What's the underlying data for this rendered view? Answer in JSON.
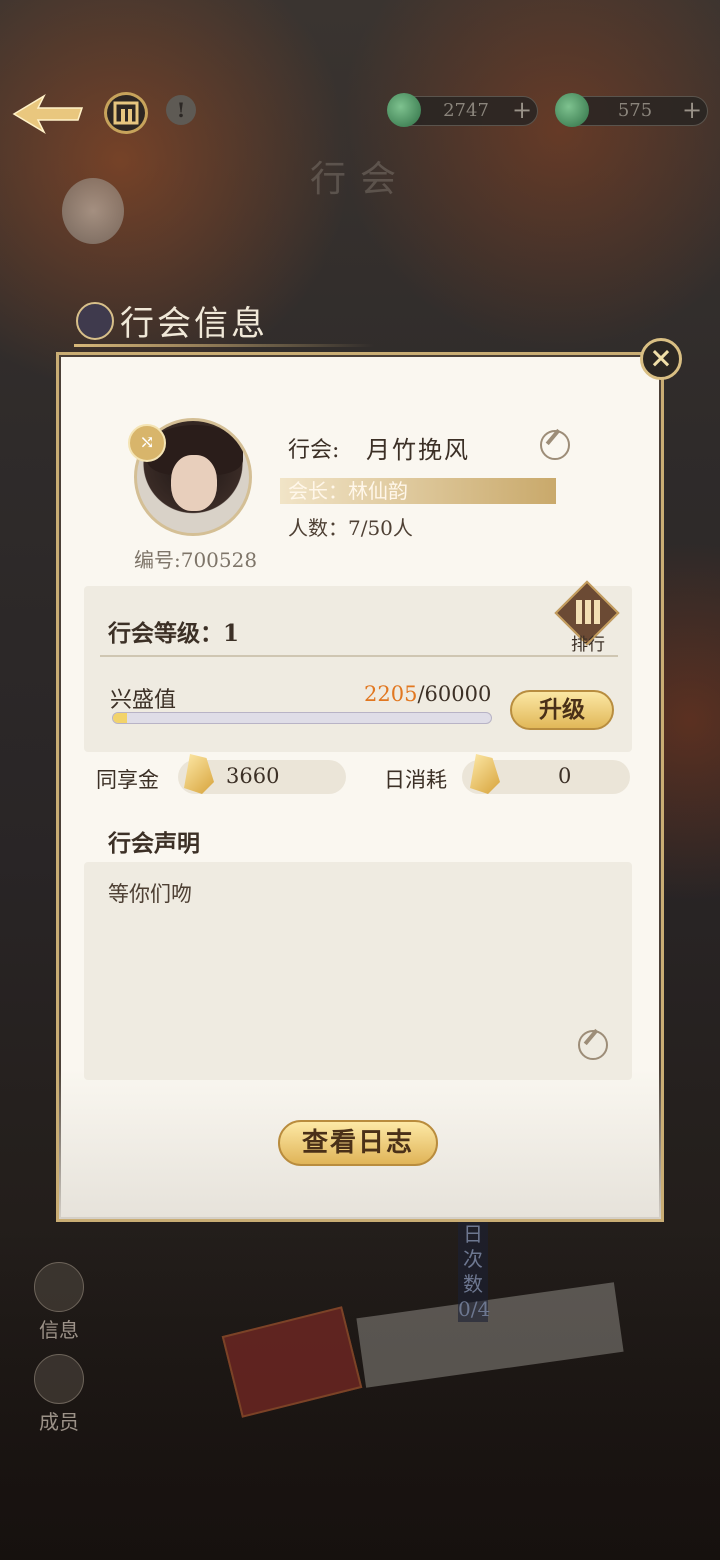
{
  "topbar": {
    "currency_jade": "2747",
    "currency_green": "575",
    "page_title": "行会"
  },
  "section": {
    "title": "行会信息"
  },
  "guild": {
    "name_label": "行会:",
    "name": "月竹挽风",
    "leader": "会长：林仙韵",
    "members": "人数：7/50人",
    "id": "编号:700528"
  },
  "level": {
    "label": "行会等级：1",
    "rank_label": "排行",
    "prosperity_label": "兴盛值",
    "prosperity_current": "2205",
    "prosperity_max": "/60000",
    "prosperity_fraction": 0.0368,
    "upgrade_label": "升级"
  },
  "funds": {
    "shared_label": "同享金",
    "shared_value": "3660",
    "daily_label": "日消耗",
    "daily_value": "0"
  },
  "statement": {
    "title": "行会声明",
    "text": "等你们吻"
  },
  "buttons": {
    "view_log": "查看日志"
  },
  "side_nav": {
    "info": "信息",
    "members": "成员"
  },
  "daily_count": "日次数0/4",
  "colors": {
    "accent_orange": "#e17720",
    "gold": "#e0b458",
    "panel_bg": "#faf7f0"
  },
  "icons": [
    "back-arrow-icon",
    "home-icon",
    "info-icon",
    "jade-coin-icon",
    "green-gem-icon",
    "plus-icon",
    "close-icon",
    "shuffle-icon",
    "edit-icon",
    "rank-icon",
    "gold-ingot-icon",
    "nav-info-icon",
    "nav-members-icon"
  ]
}
